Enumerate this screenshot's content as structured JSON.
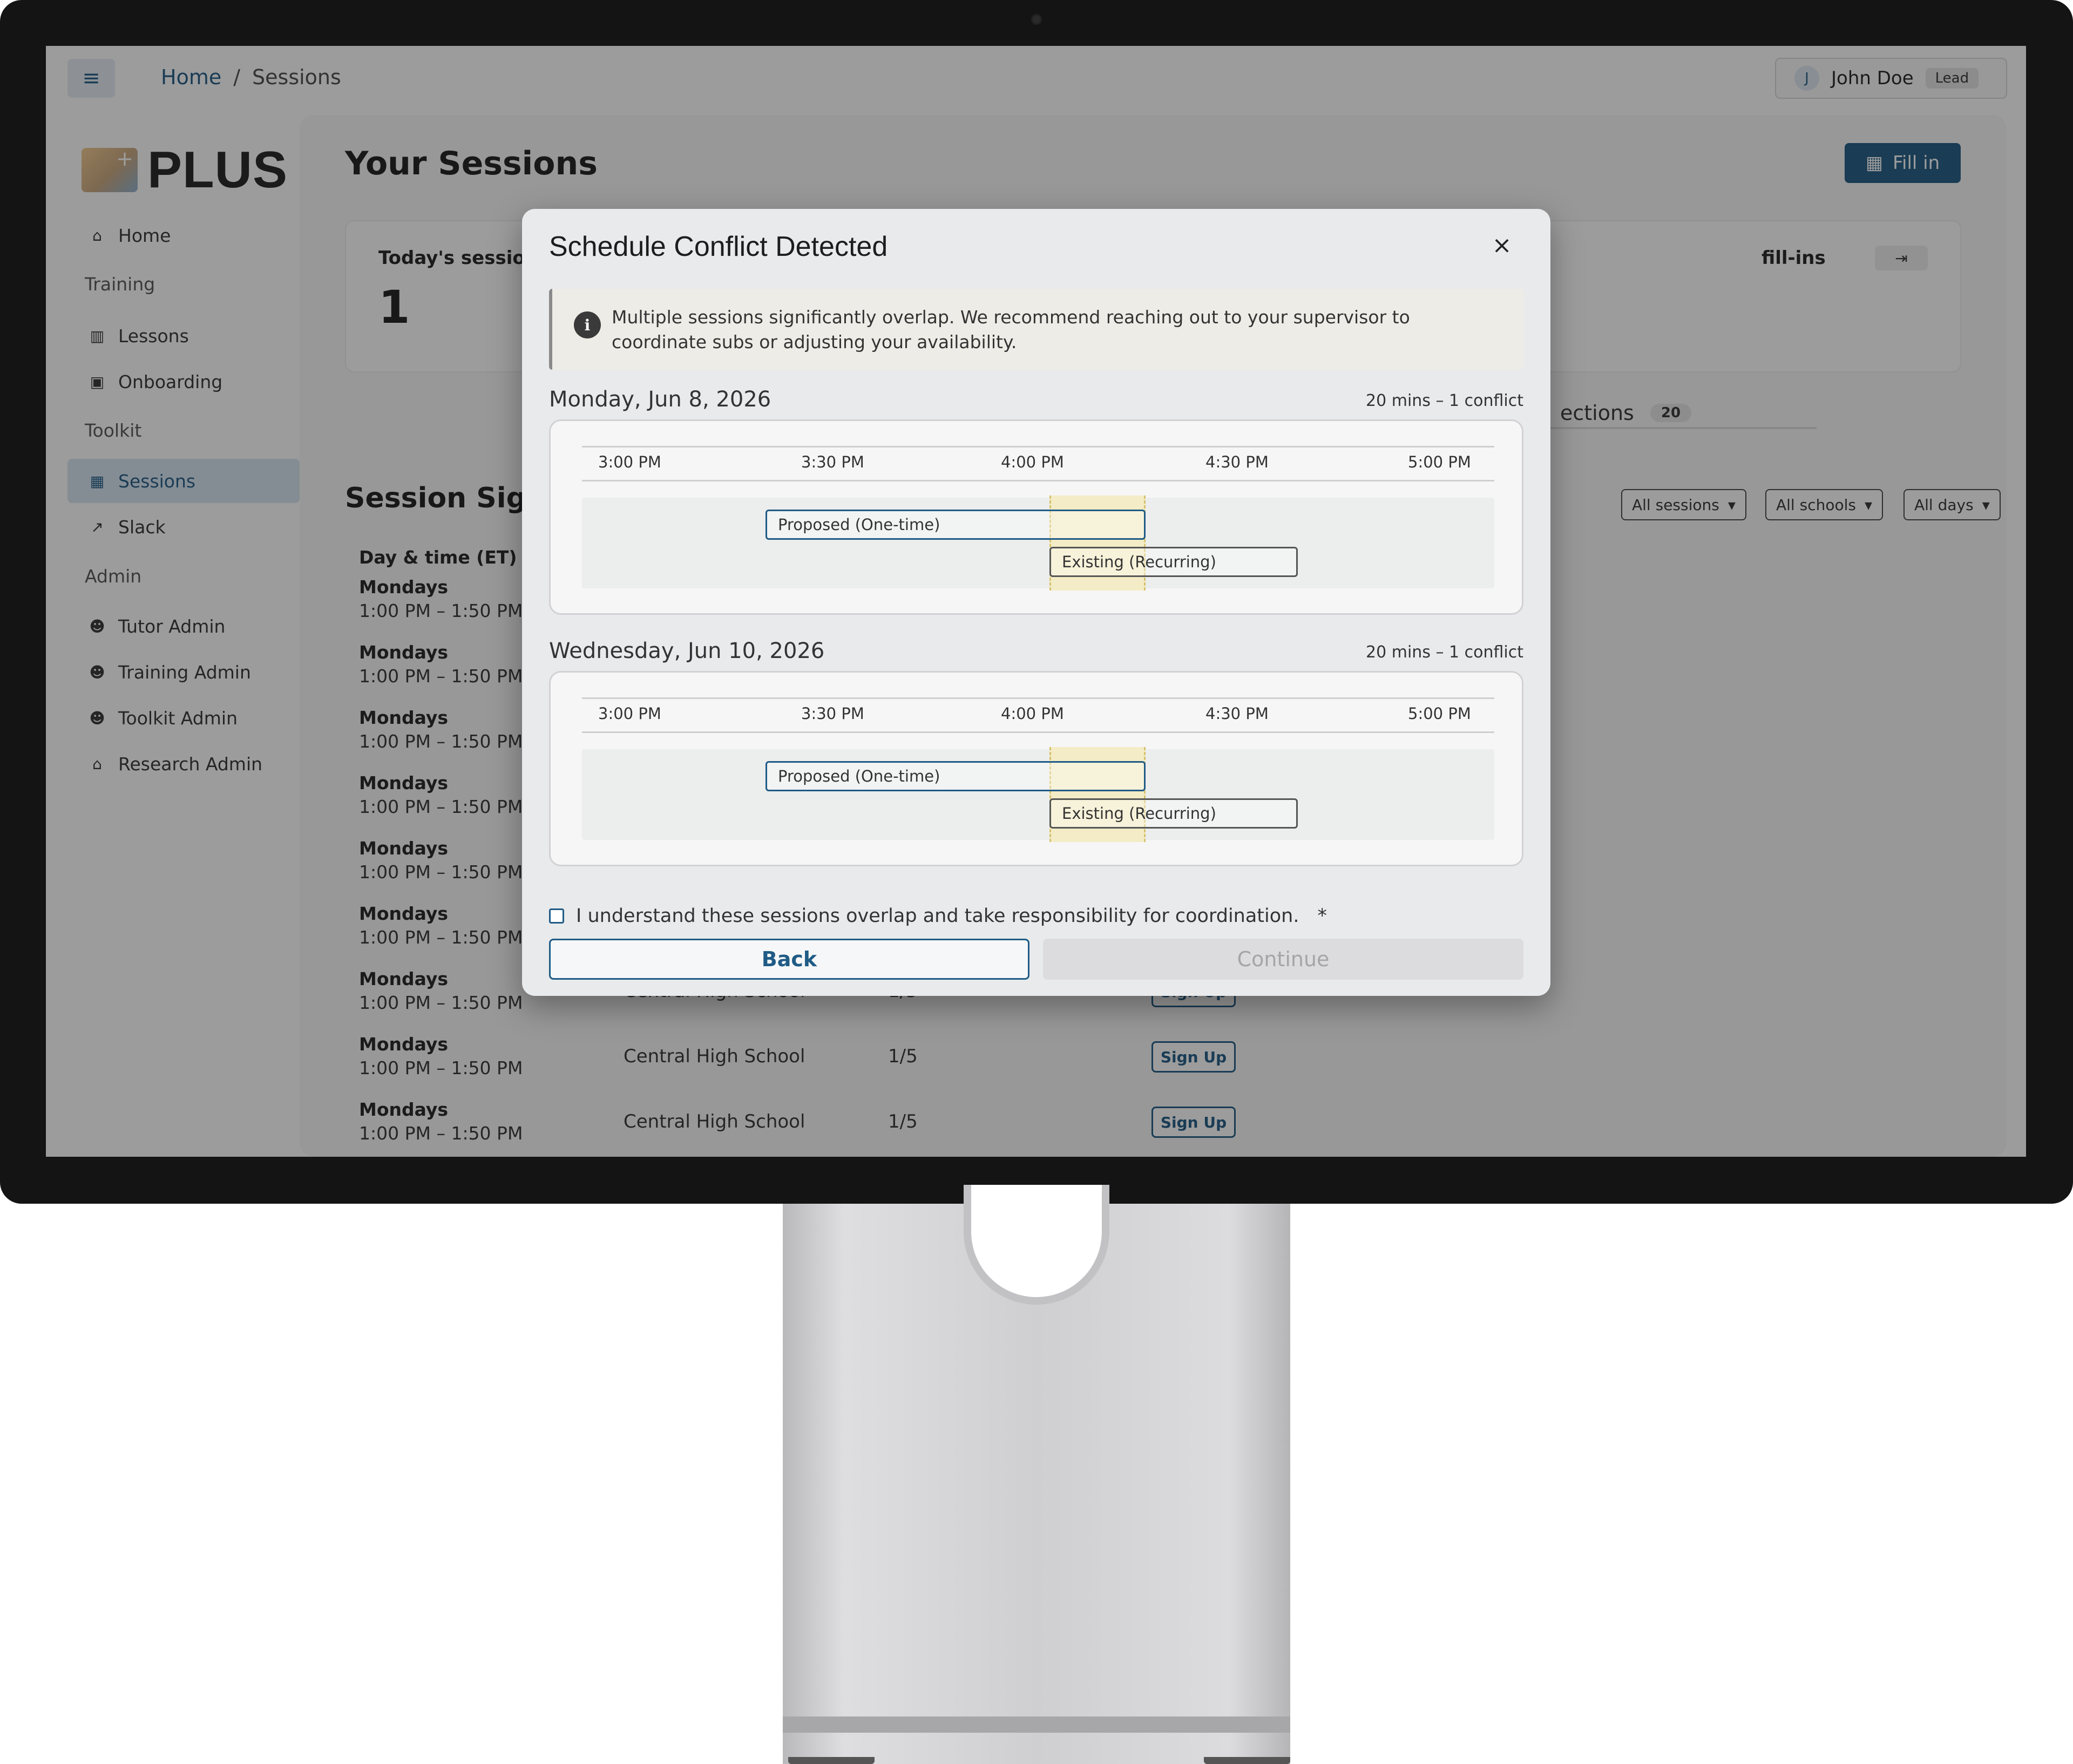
{
  "topbar": {
    "breadcrumb": [
      "Home",
      "Sessions"
    ],
    "breadcrumb_sep": "/",
    "user": {
      "initial": "J",
      "name": "John Doe",
      "role": "Lead"
    }
  },
  "sidebar": {
    "logo": "PLUS",
    "logo_mark_glyph": "+",
    "home": "Home",
    "sections": [
      {
        "title": "Training",
        "items": [
          "Lessons",
          "Onboarding"
        ]
      },
      {
        "title": "Toolkit",
        "items": [
          "Sessions",
          "Slack"
        ]
      },
      {
        "title": "Admin",
        "items": [
          "Tutor Admin",
          "Training Admin",
          "Toolkit Admin",
          "Research Admin"
        ]
      }
    ],
    "active_item": "Sessions"
  },
  "main": {
    "title": "Your Sessions",
    "fill_in_label": "Fill in",
    "card_today_label": "Today's session",
    "card_today_value": "1",
    "card_fillins_label": "fill-ins",
    "tab_label": "ections",
    "tab_count": "20",
    "signup_title": "Session Sign",
    "filters": [
      "All sessions",
      "All schools",
      "All days"
    ],
    "col_day_time": "Day & time (ET)",
    "rows": [
      {
        "day": "Mondays",
        "time": "1:00 PM – 1:50 PM",
        "school": "",
        "cap": "",
        "action": ""
      },
      {
        "day": "Mondays",
        "time": "1:00 PM – 1:50 PM",
        "school": "",
        "cap": "",
        "action": ""
      },
      {
        "day": "Mondays",
        "time": "1:00 PM – 1:50 PM",
        "school": "",
        "cap": "",
        "action": ""
      },
      {
        "day": "Mondays",
        "time": "1:00 PM – 1:50 PM",
        "school": "",
        "cap": "",
        "action": ""
      },
      {
        "day": "Mondays",
        "time": "1:00 PM – 1:50 PM",
        "school": "",
        "cap": "",
        "action": ""
      },
      {
        "day": "Mondays",
        "time": "1:00 PM – 1:50 PM",
        "school": "",
        "cap": "",
        "action": ""
      },
      {
        "day": "Mondays",
        "time": "1:00 PM – 1:50 PM",
        "school": "Central High School",
        "cap": "1/5",
        "action": "Sign Up"
      },
      {
        "day": "Mondays",
        "time": "1:00 PM – 1:50 PM",
        "school": "Central High School",
        "cap": "1/5",
        "action": "Sign Up"
      },
      {
        "day": "Mondays",
        "time": "1:00 PM – 1:50 PM",
        "school": "Central High School",
        "cap": "1/5",
        "action": "Sign Up"
      }
    ]
  },
  "modal": {
    "title": "Schedule Conflict Detected",
    "close_glyph": "×",
    "alert_icon": "i",
    "alert_text": "Multiple sessions significantly overlap. We recommend reaching out to your supervisor to coordinate subs or adjusting your availability.",
    "conflicts": [
      {
        "date": "Monday, Jun 8, 2026",
        "meta": "20 mins – 1 conflict",
        "ticks": [
          "3:00 PM",
          "3:30 PM",
          "4:00 PM",
          "4:30 PM",
          "5:00 PM"
        ],
        "proposed_label": "Proposed (One-time)",
        "existing_label": "Existing (Recurring)"
      },
      {
        "date": "Wednesday, Jun 10, 2026",
        "meta": "20 mins – 1 conflict",
        "ticks": [
          "3:00 PM",
          "3:30 PM",
          "4:00 PM",
          "4:30 PM",
          "5:00 PM"
        ],
        "proposed_label": "Proposed (One-time)",
        "existing_label": "Existing (Recurring)"
      }
    ],
    "confirm_text": "I understand these sessions overlap and take responsibility for coordination.",
    "required_mark": "*",
    "back_label": "Back",
    "continue_label": "Continue"
  },
  "icons": {
    "menu": "≡",
    "home": "⌂",
    "lessons": "▥",
    "onboarding": "▣",
    "sessions": "▦",
    "slack": "↗",
    "admin": "☻",
    "research": "⌂",
    "calendar_plus": "▦",
    "sign_in": "⇥",
    "caret": "▾"
  },
  "colors": {
    "accent": "#1f5b86",
    "overlap": "#f3ecc6"
  }
}
